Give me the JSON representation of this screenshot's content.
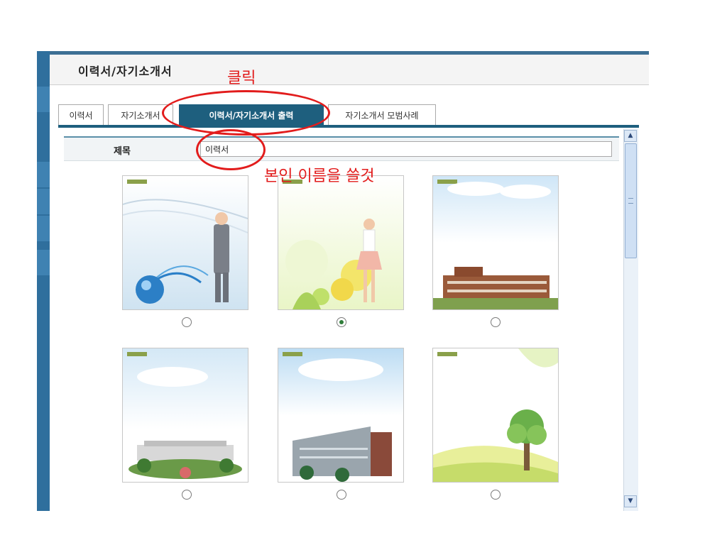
{
  "window": {
    "title": "이력서/자기소개서"
  },
  "tabs": [
    {
      "label": "이력서",
      "active": false
    },
    {
      "label": "자기소개서",
      "active": false
    },
    {
      "label": "이력서/자기소개서 출력",
      "active": true
    },
    {
      "label": "자기소개서 모범사례",
      "active": false
    }
  ],
  "form": {
    "title_label": "제목",
    "title_value": "이력서"
  },
  "templates": [
    {
      "selected": false,
      "scene": "businessman-globe"
    },
    {
      "selected": true,
      "scene": "woman-flowers"
    },
    {
      "selected": false,
      "scene": "brick-building"
    },
    {
      "selected": false,
      "scene": "campus-garden"
    },
    {
      "selected": false,
      "scene": "modern-building"
    },
    {
      "selected": false,
      "scene": "tree-field"
    }
  ],
  "annotations": {
    "click": "클릭",
    "name_hint": "본인 이름을 쓸것"
  },
  "colors": {
    "accent": "#1e5f7e",
    "annotation": "#e21c1c",
    "rail": "#2f6f9d"
  },
  "icons": {
    "scroll_up": "scroll-up-arrow-icon",
    "scroll_down": "scroll-down-arrow-icon"
  }
}
